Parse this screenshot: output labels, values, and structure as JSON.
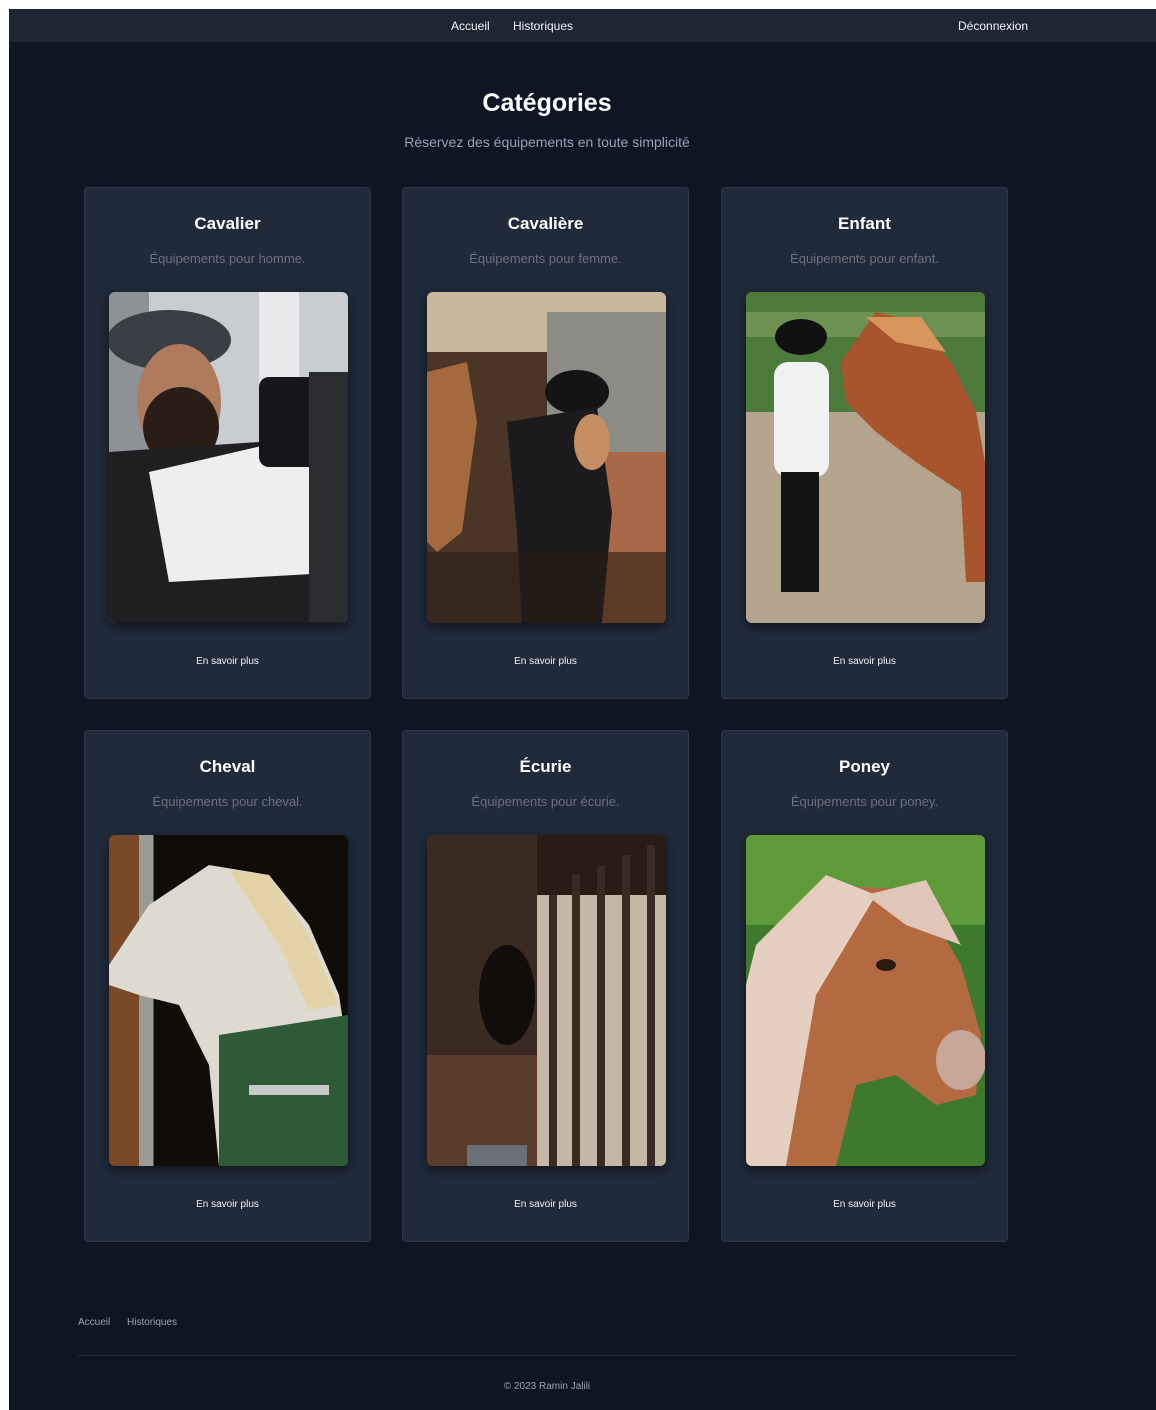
{
  "nav": {
    "links": [
      "Accueil",
      "Historiques"
    ],
    "logout": "Déconnexion"
  },
  "header": {
    "title": "Catégories",
    "subtitle": "Réservez des équipements en toute simplicité"
  },
  "categories": [
    {
      "title": "Cavalier",
      "description": "Équipements pour homme.",
      "link": "En savoir plus",
      "image": "rider-man-photo"
    },
    {
      "title": "Cavalière",
      "description": "Équipements pour femme.",
      "link": "En savoir plus",
      "image": "rider-woman-photo"
    },
    {
      "title": "Enfant",
      "description": "Équipements pour enfant.",
      "link": "En savoir plus",
      "image": "child-with-horse-photo"
    },
    {
      "title": "Cheval",
      "description": "Équipements pour cheval.",
      "link": "En savoir plus",
      "image": "white-horse-photo"
    },
    {
      "title": "Écurie",
      "description": "Équipements pour écurie.",
      "link": "En savoir plus",
      "image": "stable-photo"
    },
    {
      "title": "Poney",
      "description": "Équipements pour poney.",
      "link": "En savoir plus",
      "image": "pony-photo"
    }
  ],
  "footer": {
    "links": [
      "Accueil",
      "Historiques"
    ],
    "copyright": "© 2023 Ramin Jalili"
  }
}
